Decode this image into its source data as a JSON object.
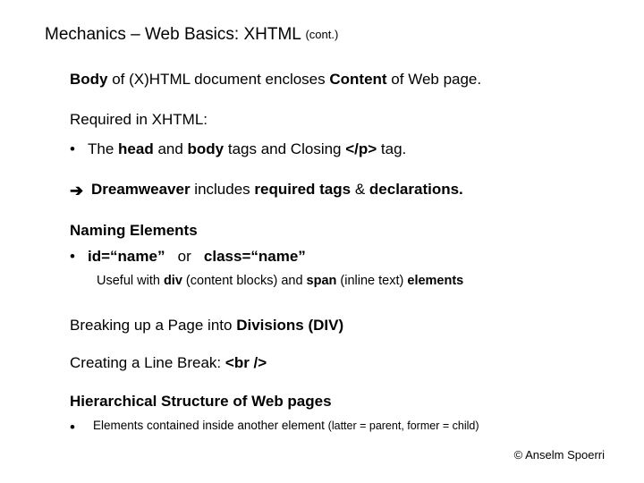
{
  "title": {
    "main": "Mechanics – Web Basics: XHTML",
    "cont": "(cont.)"
  },
  "lines": {
    "body_pre": "Body",
    "body_post": " of (X)HTML document encloses ",
    "body_content": "Content",
    "body_end": " of Web page.",
    "required": "Required in XHTML:",
    "b1_pre": "The ",
    "b1_head": "head",
    "b1_mid1": " and ",
    "b1_body": "body",
    "b1_mid2": " tags and Closing ",
    "b1_tag": "</p>",
    "b1_end": " tag.",
    "arrow_dw": "Dreamweaver",
    "arrow_mid": " includes ",
    "arrow_req": "required tags",
    "arrow_amp": " & ",
    "arrow_decl": "declarations.",
    "naming_h": "Naming Elements",
    "naming_id": "id=“name”",
    "naming_or": "   or   ",
    "naming_class": "class=“name”",
    "useful_pre": "Useful with ",
    "useful_div": "div",
    "useful_mid1": " (content blocks) and ",
    "useful_span": "span",
    "useful_mid2": " (inline text) ",
    "useful_elem": "elements",
    "breaking_pre": "Breaking up a Page into ",
    "breaking_div": "Divisions (DIV)",
    "linebreak_pre": "Creating a Line Break: ",
    "linebreak_tag": "<br />",
    "hier": "Hierarchical Structure of Web pages",
    "hier_sub_pre": "Elements contained inside another element ",
    "hier_sub_paren": "(latter = parent, former = child)",
    "copyright": "© Anselm Spoerri"
  },
  "glyph": {
    "bullet": "•",
    "arrow": "➔"
  }
}
